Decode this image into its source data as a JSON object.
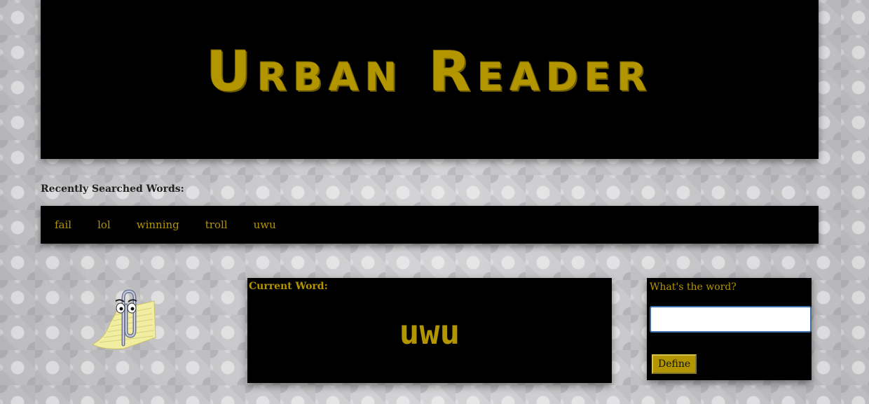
{
  "banner": {
    "title": "Urban Reader"
  },
  "recent": {
    "heading": "Recently Searched Words:",
    "words": [
      "fail",
      "lol",
      "winning",
      "troll",
      "uwu"
    ]
  },
  "current": {
    "label": "Current Word:",
    "word": "uwu"
  },
  "search": {
    "label": "What's the word?",
    "value": "",
    "button_label": "Define"
  },
  "theme": {
    "accent": "#b39500",
    "panel": "#000000"
  }
}
